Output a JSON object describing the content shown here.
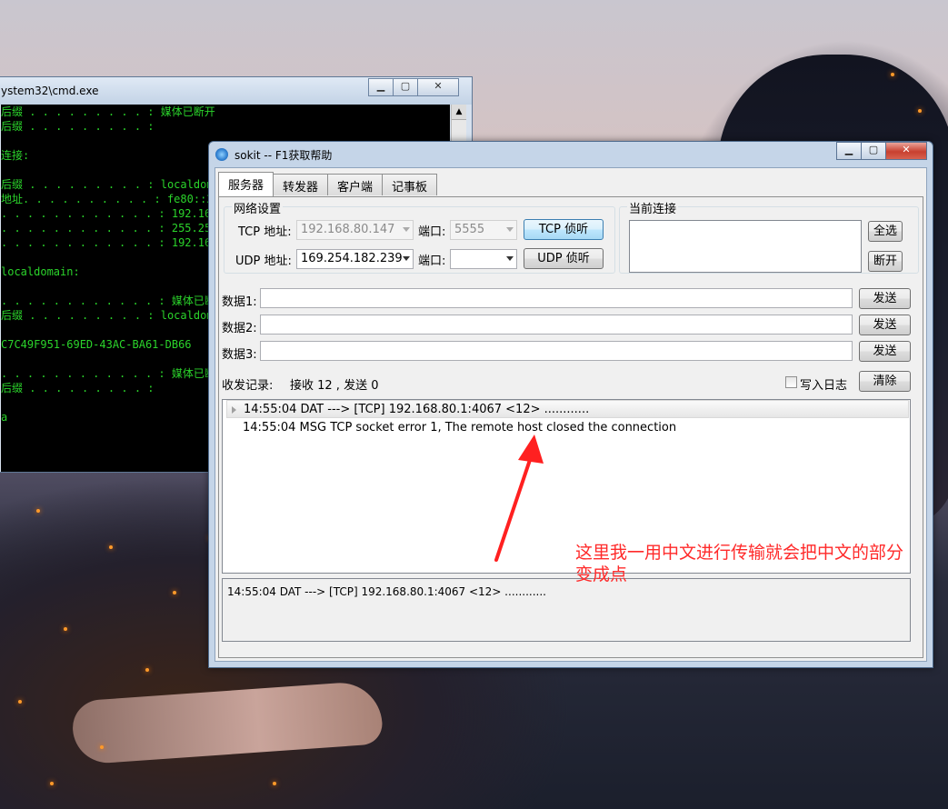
{
  "cmd_window": {
    "title": "ystem32\\cmd.exe",
    "lines": [
      "后缀 . . . . . . . . . : 媒体已断开",
      "后缀 . . . . . . . . . :",
      "",
      "连接:",
      "",
      "后缀 . . . . . . . . . : localdom",
      "地址. . . . . . . . . . : fe80::24",
      ". . . . . . . . . . . . : 192.168.",
      ". . . . . . . . . . . . : 255.255.",
      ". . . . . . . . . . . . : 192.168.",
      "",
      "localdomain:",
      "",
      ". . . . . . . . . . . . : 媒体已断",
      "后缀 . . . . . . . . . : localdom",
      "",
      "C7C49F951-69ED-43AC-BA61-DB66",
      "",
      ". . . . . . . . . . . . : 媒体已断",
      "后缀 . . . . . . . . . :",
      "",
      "a"
    ]
  },
  "sokit": {
    "title": "sokit -- F1获取帮助",
    "tabs": [
      "服务器",
      "转发器",
      "客户端",
      "记事板"
    ],
    "network_group": {
      "title": "网络设置",
      "tcp_label": "TCP 地址:",
      "tcp_addr": "192.168.80.147",
      "tcp_port_label": "端口:",
      "tcp_port": "5555",
      "tcp_button": "TCP 侦听",
      "udp_label": "UDP 地址:",
      "udp_addr": "169.254.182.239",
      "udp_port_label": "端口:",
      "udp_port": "",
      "udp_button": "UDP 侦听"
    },
    "conn_group": {
      "title": "当前连接",
      "select_all": "全选",
      "disconnect": "断开"
    },
    "data_rows": [
      {
        "label": "数据1:",
        "value": "",
        "send": "发送"
      },
      {
        "label": "数据2:",
        "value": "",
        "send": "发送"
      },
      {
        "label": "数据3:",
        "value": "",
        "send": "发送"
      }
    ],
    "log_header": {
      "title": "收发记录:",
      "stats": "接收 12 , 发送 0",
      "write_log": "写入日志",
      "clear": "清除"
    },
    "log_entries": [
      "14:55:04 DAT ---> [TCP] 192.168.80.1:4067 <12> ............",
      "14:55:04 MSG TCP socket error 1, The remote host closed the connection"
    ],
    "detail_text": "14:55:04 DAT ---> [TCP] 192.168.80.1:4067 <12> ............"
  },
  "annotation": {
    "text": "这里我一用中文进行传输就会把中文的部分变成点",
    "color": "#ff2a2a"
  },
  "colors": {
    "terminal_text": "#2bd42b",
    "window_frame": "#c5d5e8",
    "close_button": "#c8402f"
  }
}
